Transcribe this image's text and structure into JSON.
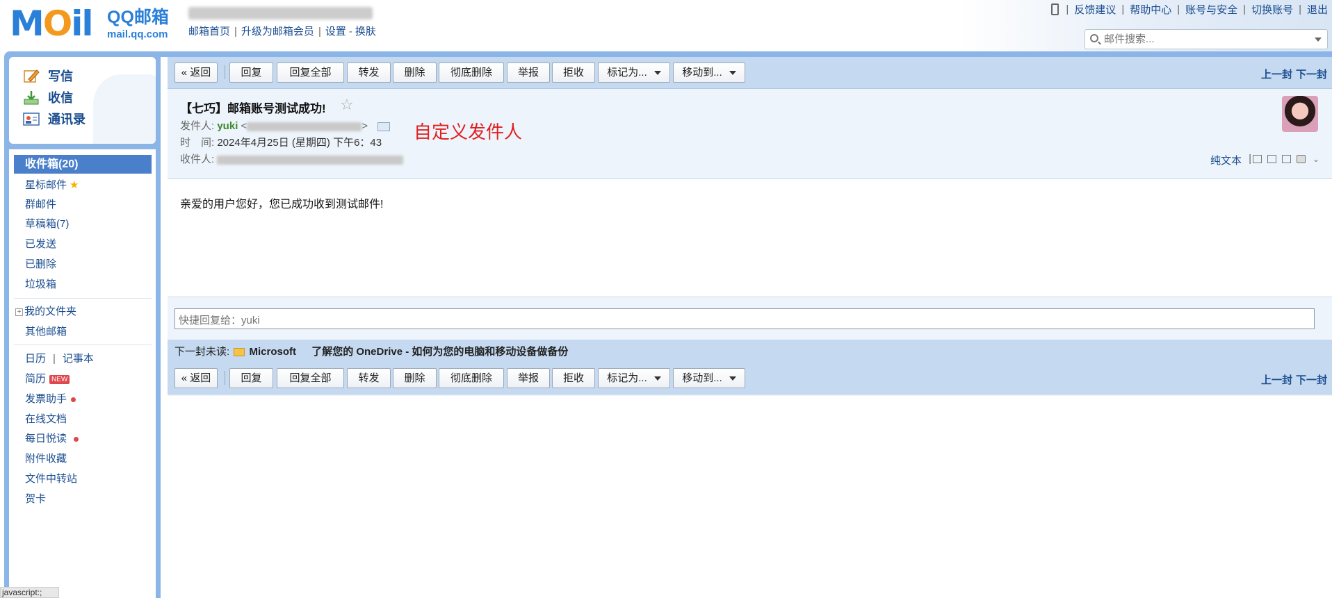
{
  "logo": {
    "mail_word": "MOil",
    "brand": "QQ邮箱",
    "domain": "mail.qq.com"
  },
  "header": {
    "links": [
      "邮箱首页",
      "升级为邮箱会员",
      "设置",
      "换肤"
    ],
    "right_links": [
      "反馈建议",
      "帮助中心",
      "账号与安全",
      "切换账号",
      "退出"
    ],
    "search_placeholder": "邮件搜索..."
  },
  "sidebar": {
    "compose": "写信",
    "receive": "收信",
    "contacts": "通讯录",
    "inbox": "收件箱(20)",
    "folders": [
      "星标邮件",
      "群邮件",
      "草稿箱(7)",
      "已发送",
      "已删除",
      "垃圾箱"
    ],
    "my_folders": "我的文件夹",
    "other_mailbox": "其他邮箱",
    "calendar": "日历",
    "notes": "记事本",
    "resume": "简历",
    "new_badge": "NEW",
    "apps": [
      "发票助手",
      "在线文档",
      "每日悦读",
      "附件收藏",
      "文件中转站",
      "贺卡"
    ]
  },
  "toolbar": {
    "back": "« 返回",
    "buttons": [
      "回复",
      "回复全部",
      "转发",
      "删除",
      "彻底删除",
      "举报",
      "拒收"
    ],
    "mark_as": "标记为...",
    "move_to": "移动到...",
    "prev": "上一封",
    "next": "下一封"
  },
  "mail": {
    "subject": "【七巧】邮箱账号测试成功!",
    "from_label": "发件人:",
    "from_name": "yuki",
    "time_label": "时　间:",
    "time": "2024年4月25日 (星期四) 下午6：43",
    "to_label": "收件人:",
    "annotation": "自定义发件人",
    "plain_text": "纯文本",
    "body": "亲爱的用户您好，您已成功收到测试邮件!",
    "quick_reply_placeholder": "快捷回复给：yuki"
  },
  "next_unread": {
    "label": "下一封未读:",
    "sender": "Microsoft",
    "subject": "了解您的 OneDrive - 如何为您的电脑和移动设备做备份"
  },
  "status_bar": "javascript:;"
}
